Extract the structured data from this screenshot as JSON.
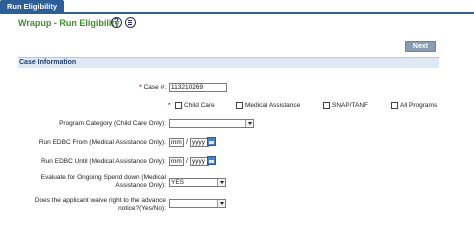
{
  "tab": {
    "label": "Run Eligibility"
  },
  "page": {
    "title": "Wrapup - Run Eligibility",
    "help_glyph": "?"
  },
  "buttons": {
    "next": "Next"
  },
  "section": {
    "title": "Case Information"
  },
  "case": {
    "label": "Case #:",
    "value": "113210269",
    "required_mark": "*"
  },
  "programs": {
    "required_mark": "*",
    "items": [
      {
        "label": "Child Care"
      },
      {
        "label": "Medical Assistance"
      },
      {
        "label": "SNAP/TANF"
      },
      {
        "label": "All Programs"
      }
    ]
  },
  "program_category": {
    "label": "Program Category (Child Care Only):",
    "value": ""
  },
  "edbc_from": {
    "label": "Run EDBC From (Medical Assistance Only):",
    "mm": "mm",
    "yyyy": "yyyy"
  },
  "edbc_until": {
    "label": "Run EDBC Until (Medical Assistance Only):",
    "mm": "mm",
    "yyyy": "yyyy"
  },
  "spend_down": {
    "label_line1": "Evaluate for Ongoing Spend down (Medical",
    "label_line2": "Assistance Only):",
    "value": "YES"
  },
  "waive": {
    "label_line1": "Does the applicant waive right to the advance",
    "label_line2": "notice?(Yes/No):",
    "value": ""
  },
  "date_separator": "/",
  "colors": {
    "tab": "#2c5f96",
    "title": "#3e8e2f",
    "section_bg": "#dfe9f6",
    "required": "#c0392b"
  },
  "icons": {
    "help": "question-circle-icon",
    "doc": "document-circle-icon",
    "calendar": "calendar-icon"
  }
}
